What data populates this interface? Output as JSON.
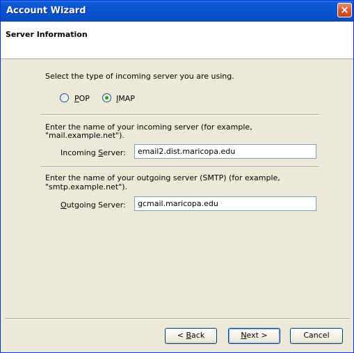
{
  "window": {
    "title": "Account Wizard",
    "close_icon": "×"
  },
  "header": {
    "title": "Server Information"
  },
  "server_type": {
    "prompt": "Select the type of incoming server you are using.",
    "options": [
      {
        "label": "POP",
        "selected": false
      },
      {
        "label": "IMAP",
        "selected": true
      }
    ]
  },
  "incoming": {
    "instructions_line1": "Enter the name of your incoming server (for example,",
    "instructions_line2": "\"mail.example.net\").",
    "label": "Incoming Server:",
    "value": "email2.dist.maricopa.edu"
  },
  "outgoing": {
    "instructions_line1": "Enter the name of your outgoing server (SMTP) (for example,",
    "instructions_line2": "\"smtp.example.net\").",
    "label": "Outgoing Server:",
    "value": "gcmail.maricopa.edu"
  },
  "buttons": {
    "back": "< Back",
    "next": "Next >",
    "cancel": "Cancel"
  },
  "colors": {
    "titlebar": "#0a54d0",
    "close": "#d6582f",
    "radio_dot": "#21a121"
  }
}
